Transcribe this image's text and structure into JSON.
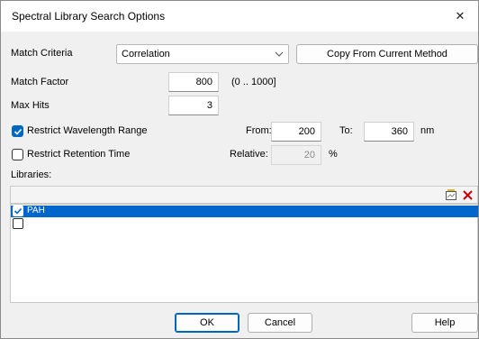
{
  "window": {
    "title": "Spectral Library Search Options",
    "close_glyph": "✕"
  },
  "match_criteria": {
    "label": "Match Criteria",
    "value": "Correlation",
    "copy_button": "Copy From Current Method"
  },
  "match_factor": {
    "label": "Match Factor",
    "value": "800",
    "range_hint": "(0 .. 1000]"
  },
  "max_hits": {
    "label": "Max Hits",
    "value": "3"
  },
  "wavelength": {
    "label": "Restrict Wavelength Range",
    "checked": true,
    "from_label": "From:",
    "from_value": "200",
    "to_label": "To:",
    "to_value": "360",
    "unit": "nm"
  },
  "retention": {
    "label": "Restrict Retention Time",
    "checked": false,
    "relative_label": "Relative:",
    "relative_value": "20",
    "unit": "%"
  },
  "libraries": {
    "label": "Libraries:",
    "items": [
      {
        "name": "PAH",
        "checked": true,
        "selected": true
      },
      {
        "name": "",
        "checked": false,
        "selected": false
      }
    ]
  },
  "footer": {
    "ok": "OK",
    "cancel": "Cancel",
    "help": "Help"
  },
  "colors": {
    "accent": "#0067c0",
    "selection": "#0066cc",
    "delete_icon": "#cc0000"
  },
  "icons": {
    "new_library": "new-library-icon",
    "delete_library": "delete-icon",
    "dropdown": "chevron-down-icon",
    "close": "close-icon"
  }
}
